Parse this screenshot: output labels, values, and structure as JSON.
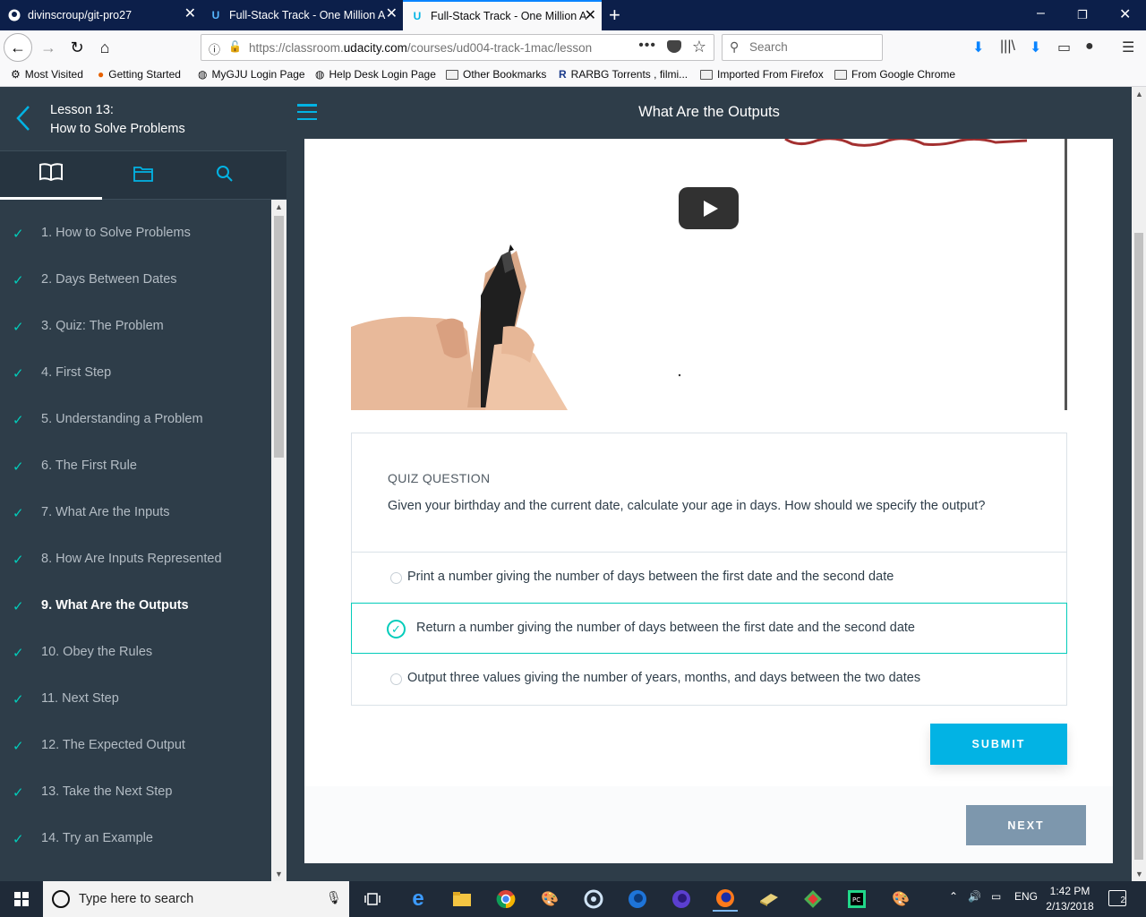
{
  "browser": {
    "tabs": [
      {
        "title": "divinscroup/git-pro27",
        "icon": "github-icon",
        "active": false
      },
      {
        "title": "Full-Stack Track - One Million A",
        "icon": "udacity-icon",
        "active": false
      },
      {
        "title": "Full-Stack Track - One Million A",
        "icon": "udacity-icon",
        "active": true
      }
    ],
    "url_prefix": "https://classroom.",
    "url_domain": "udacity.com",
    "url_rest": "/courses/ud004-track-1mac/lesson",
    "search_placeholder": "Search",
    "bookmarks": [
      "Most Visited",
      "Getting Started",
      "MyGJU Login Page",
      "Help Desk Login Page",
      "Other Bookmarks",
      "RARBG Torrents , filmi...",
      "Imported From Firefox",
      "From Google Chrome"
    ]
  },
  "sidebar": {
    "lesson_number": "Lesson 13:",
    "lesson_title": "How to Solve Problems",
    "items": [
      {
        "label": "1. How to Solve Problems",
        "done": true,
        "current": false
      },
      {
        "label": "2. Days Between Dates",
        "done": true,
        "current": false
      },
      {
        "label": "3. Quiz: The Problem",
        "done": true,
        "current": false
      },
      {
        "label": "4. First Step",
        "done": true,
        "current": false
      },
      {
        "label": "5. Understanding a Problem",
        "done": true,
        "current": false
      },
      {
        "label": "6. The First Rule",
        "done": true,
        "current": false
      },
      {
        "label": "7. What Are the Inputs",
        "done": true,
        "current": false
      },
      {
        "label": "8. How Are Inputs Represented",
        "done": true,
        "current": false
      },
      {
        "label": "9. What Are the Outputs",
        "done": true,
        "current": true
      },
      {
        "label": "10. Obey the Rules",
        "done": true,
        "current": false
      },
      {
        "label": "11. Next Step",
        "done": true,
        "current": false
      },
      {
        "label": "12. The Expected Output",
        "done": true,
        "current": false
      },
      {
        "label": "13. Take the Next Step",
        "done": true,
        "current": false
      },
      {
        "label": "14. Try an Example",
        "done": true,
        "current": false
      }
    ]
  },
  "header": {
    "title": "What Are the Outputs"
  },
  "quiz": {
    "label": "QUIZ QUESTION",
    "question": "Given your birthday and the current date, calculate your age in days. How should we specify the output?",
    "options": [
      {
        "text": "Print a number giving the number of days between the first date and the second date",
        "selected": false
      },
      {
        "text": "Return a number giving the number of days between the first date and the second date",
        "selected": true
      },
      {
        "text": "Output three values giving the number of years, months, and days between the two dates",
        "selected": false
      }
    ],
    "submit_label": "SUBMIT"
  },
  "next_label": "NEXT",
  "taskbar": {
    "search_placeholder": "Type here to search",
    "language": "ENG",
    "time": "1:42 PM",
    "date": "2/13/2018",
    "notification_count": "2"
  },
  "colors": {
    "sidebar_bg": "#2e3d49",
    "accent": "#02b3e4",
    "check": "#02ccba",
    "next_button": "#7d97ad"
  }
}
